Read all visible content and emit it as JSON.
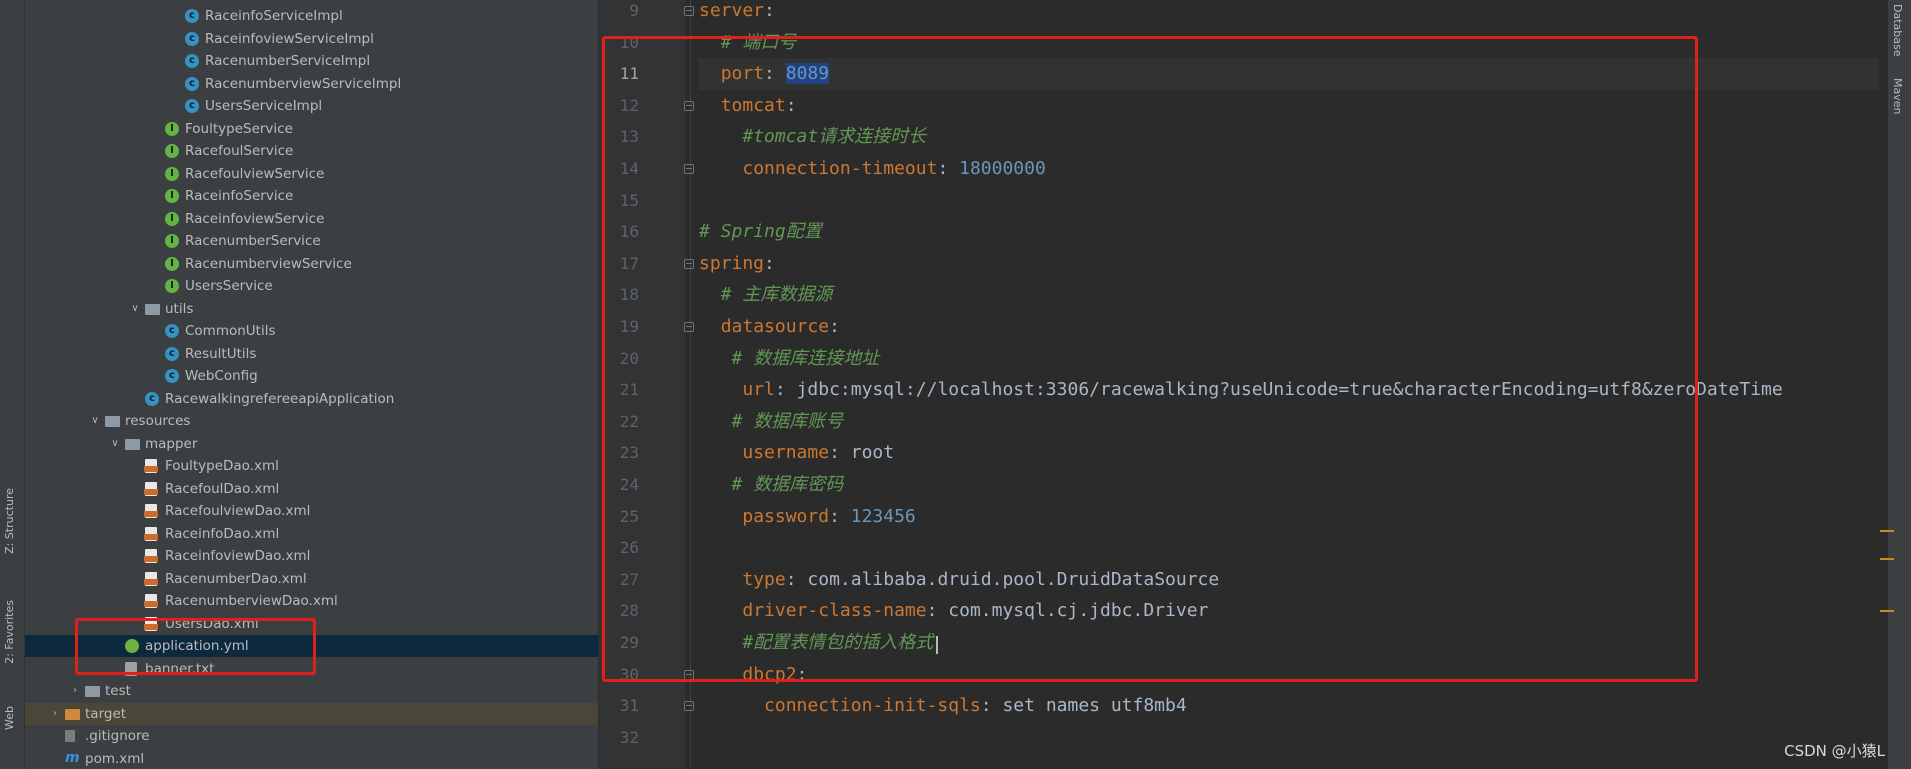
{
  "left_toolwindows": [
    "Z: Structure",
    "2: Favorites",
    "Web"
  ],
  "right_toolwindows": [
    "Database",
    "Maven"
  ],
  "project_tree": [
    {
      "label": "RaceinfoServiceImpl",
      "icon": "class",
      "depth": 8
    },
    {
      "label": "RaceinfoviewServiceImpl",
      "icon": "class",
      "depth": 8
    },
    {
      "label": "RacenumberServiceImpl",
      "icon": "class",
      "depth": 8
    },
    {
      "label": "RacenumberviewServiceImpl",
      "icon": "class",
      "depth": 8
    },
    {
      "label": "UsersServiceImpl",
      "icon": "class",
      "depth": 8
    },
    {
      "label": "FoultypeService",
      "icon": "interface",
      "depth": 7
    },
    {
      "label": "RacefoulService",
      "icon": "interface",
      "depth": 7
    },
    {
      "label": "RacefoulviewService",
      "icon": "interface",
      "depth": 7
    },
    {
      "label": "RaceinfoService",
      "icon": "interface",
      "depth": 7
    },
    {
      "label": "RaceinfoviewService",
      "icon": "interface",
      "depth": 7
    },
    {
      "label": "RacenumberService",
      "icon": "interface",
      "depth": 7
    },
    {
      "label": "RacenumberviewService",
      "icon": "interface",
      "depth": 7
    },
    {
      "label": "UsersService",
      "icon": "interface",
      "depth": 7
    },
    {
      "label": "utils",
      "icon": "folder",
      "depth": 6,
      "expanded": true
    },
    {
      "label": "CommonUtils",
      "icon": "class",
      "depth": 7
    },
    {
      "label": "ResultUtils",
      "icon": "class",
      "depth": 7
    },
    {
      "label": "WebConfig",
      "icon": "class",
      "depth": 7
    },
    {
      "label": "RacewalkingrefereeapiApplication",
      "icon": "class",
      "depth": 6
    },
    {
      "label": "resources",
      "icon": "folder",
      "depth": 4,
      "expanded": true
    },
    {
      "label": "mapper",
      "icon": "folder",
      "depth": 5,
      "expanded": true
    },
    {
      "label": "FoultypeDao.xml",
      "icon": "xml",
      "depth": 6
    },
    {
      "label": "RacefoulDao.xml",
      "icon": "xml",
      "depth": 6
    },
    {
      "label": "RacefoulviewDao.xml",
      "icon": "xml",
      "depth": 6
    },
    {
      "label": "RaceinfoDao.xml",
      "icon": "xml",
      "depth": 6
    },
    {
      "label": "RaceinfoviewDao.xml",
      "icon": "xml",
      "depth": 6
    },
    {
      "label": "RacenumberDao.xml",
      "icon": "xml",
      "depth": 6
    },
    {
      "label": "RacenumberviewDao.xml",
      "icon": "xml",
      "depth": 6
    },
    {
      "label": "UsersDao.xml",
      "icon": "xml",
      "depth": 6
    },
    {
      "label": "application.yml",
      "icon": "spring",
      "depth": 5,
      "selected": true
    },
    {
      "label": "banner.txt",
      "icon": "txt",
      "depth": 5
    },
    {
      "label": "test",
      "icon": "folder",
      "depth": 3,
      "expanded": false
    },
    {
      "label": "target",
      "icon": "folder-orange",
      "depth": 2,
      "expanded": false,
      "tinted": true
    },
    {
      "label": ".gitignore",
      "icon": "git",
      "depth": 2
    },
    {
      "label": "pom.xml",
      "icon": "maven",
      "depth": 2
    }
  ],
  "editor": {
    "current_line": 11,
    "lines": [
      {
        "n": 9,
        "indent": 0,
        "key": "server",
        "comment": "",
        "value": "",
        "value_type": "",
        "fold": true
      },
      {
        "n": 10,
        "indent": 2,
        "key": "",
        "comment": "# 端口号",
        "value": "",
        "value_type": ""
      },
      {
        "n": 11,
        "indent": 2,
        "key": "port",
        "comment": "",
        "value": "8089",
        "value_type": "number",
        "selected": true
      },
      {
        "n": 12,
        "indent": 2,
        "key": "tomcat",
        "comment": "",
        "value": "",
        "value_type": "",
        "fold": true
      },
      {
        "n": 13,
        "indent": 4,
        "key": "",
        "comment": "#tomcat请求连接时长",
        "value": "",
        "value_type": ""
      },
      {
        "n": 14,
        "indent": 4,
        "key": "connection-timeout",
        "comment": "",
        "value": "18000000",
        "value_type": "number",
        "fold_end": true
      },
      {
        "n": 15,
        "indent": 0,
        "key": "",
        "comment": "",
        "value": "",
        "value_type": ""
      },
      {
        "n": 16,
        "indent": 0,
        "key": "",
        "comment": "# Spring配置",
        "value": "",
        "value_type": ""
      },
      {
        "n": 17,
        "indent": 0,
        "key": "spring",
        "comment": "",
        "value": "",
        "value_type": "",
        "fold": true
      },
      {
        "n": 18,
        "indent": 2,
        "key": "",
        "comment": "# 主库数据源",
        "value": "",
        "value_type": ""
      },
      {
        "n": 19,
        "indent": 2,
        "key": "datasource",
        "comment": "",
        "value": "",
        "value_type": "",
        "fold": true
      },
      {
        "n": 20,
        "indent": 3,
        "key": "",
        "comment": "# 数据库连接地址",
        "value": "",
        "value_type": ""
      },
      {
        "n": 21,
        "indent": 4,
        "key": "url",
        "comment": "",
        "value": "jdbc:mysql://localhost:3306/racewalking?useUnicode=true&characterEncoding=utf8&zeroDateTime",
        "value_type": "text"
      },
      {
        "n": 22,
        "indent": 3,
        "key": "",
        "comment": "# 数据库账号",
        "value": "",
        "value_type": ""
      },
      {
        "n": 23,
        "indent": 4,
        "key": "username",
        "comment": "",
        "value": "root",
        "value_type": "text"
      },
      {
        "n": 24,
        "indent": 3,
        "key": "",
        "comment": "# 数据库密码",
        "value": "",
        "value_type": ""
      },
      {
        "n": 25,
        "indent": 4,
        "key": "password",
        "comment": "",
        "value": "123456",
        "value_type": "number"
      },
      {
        "n": 26,
        "indent": 0,
        "key": "",
        "comment": "",
        "value": "",
        "value_type": ""
      },
      {
        "n": 27,
        "indent": 4,
        "key": "type",
        "comment": "",
        "value": "com.alibaba.druid.pool.DruidDataSource",
        "value_type": "class"
      },
      {
        "n": 28,
        "indent": 4,
        "key": "driver-class-name",
        "comment": "",
        "value": "com.mysql.cj.jdbc.Driver",
        "value_type": "class"
      },
      {
        "n": 29,
        "indent": 4,
        "key": "",
        "comment": "#配置表情包的插入格式",
        "value": "",
        "value_type": ""
      },
      {
        "n": 30,
        "indent": 4,
        "key": "dbcp2",
        "comment": "",
        "value": "",
        "value_type": "",
        "fold": true
      },
      {
        "n": 31,
        "indent": 6,
        "key": "connection-init-sqls",
        "comment": "",
        "value": "set names utf8mb4",
        "value_type": "text",
        "fold_end": true
      },
      {
        "n": 32,
        "indent": 0,
        "key": "",
        "comment": "",
        "value": "",
        "value_type": ""
      }
    ]
  },
  "watermark": "CSDN @小猿L",
  "colors": {
    "highlight_box": "#e0201b",
    "selection": "#214283",
    "key": "#cc7832",
    "comment": "#629755",
    "number": "#6897bb"
  }
}
